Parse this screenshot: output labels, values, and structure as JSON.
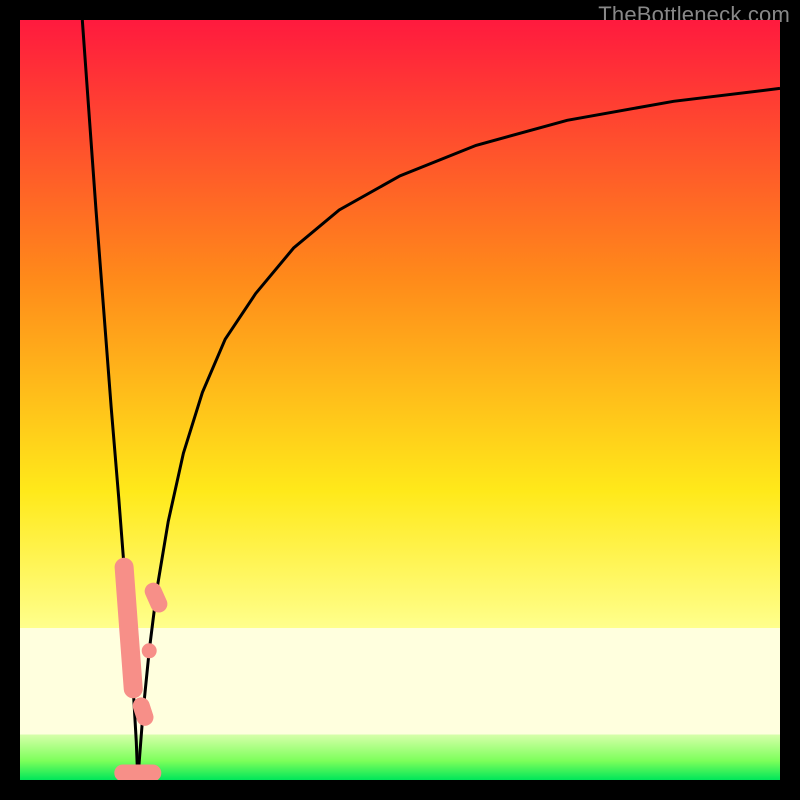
{
  "attribution": "TheBottleneck.com",
  "colors": {
    "top": "#ff1a3e",
    "orange": "#ff8a1a",
    "yellow": "#ffe91a",
    "paleyellow": "#ffff8c",
    "green_top": "#7cff5a",
    "green_bot": "#00e65a",
    "curve": "#000000",
    "marker_fill": "#f78f88",
    "marker_stroke": "#f78f88"
  },
  "chart_data": {
    "type": "line",
    "title": "",
    "xlabel": "",
    "ylabel": "",
    "xlim": [
      0,
      100
    ],
    "ylim": [
      0,
      100
    ],
    "x_valley": 15.5,
    "curve_left": {
      "comment": "descending branch from top-left into valley",
      "x": [
        8.2,
        10,
        11,
        12,
        13,
        13.7,
        14.3,
        14.9,
        15.3,
        15.5
      ],
      "y": [
        100,
        75,
        62,
        49,
        37,
        28,
        20,
        12,
        5,
        0
      ]
    },
    "curve_right": {
      "comment": "ascending branch from valley rising and flattening toward upper right",
      "x": [
        15.5,
        16.2,
        17,
        18,
        19.5,
        21.5,
        24,
        27,
        31,
        36,
        42,
        50,
        60,
        72,
        86,
        100
      ],
      "y": [
        0,
        9,
        17,
        25,
        34,
        43,
        51,
        58,
        64,
        70,
        75,
        79.5,
        83.5,
        86.8,
        89.3,
        91
      ]
    },
    "series": [
      {
        "name": "markers-left",
        "shape": "capsule",
        "x": [
          13.7,
          14.3,
          14.9
        ],
        "y": [
          28,
          20,
          12
        ]
      },
      {
        "name": "markers-right",
        "shape": "dot-and-capsule",
        "x": [
          16.2,
          17.0,
          17.9
        ],
        "y": [
          9,
          17,
          24
        ]
      },
      {
        "name": "markers-bottom",
        "shape": "bar",
        "x": [
          15.5
        ],
        "y": [
          0
        ]
      }
    ]
  }
}
